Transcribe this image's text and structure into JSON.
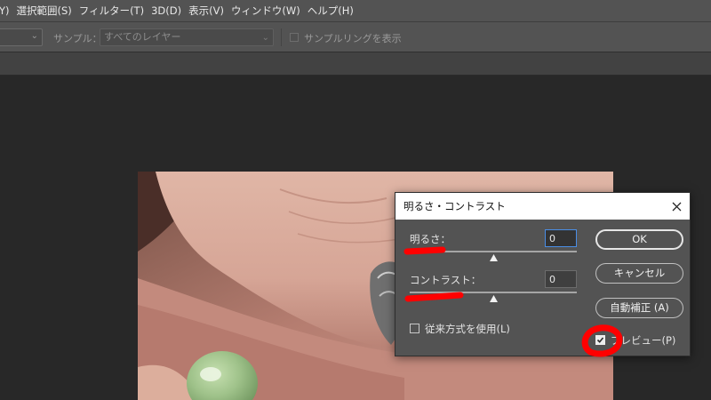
{
  "menu": [
    {
      "label": "Y)"
    },
    {
      "label": "選択範囲(S)"
    },
    {
      "label": "フィルター(T)"
    },
    {
      "label": "3D(D)"
    },
    {
      "label": "表示(V)"
    },
    {
      "label": "ウィンドウ(W)"
    },
    {
      "label": "ヘルプ(H)"
    }
  ],
  "options_bar": {
    "sample_label": "サンプル：",
    "sample_value": "すべてのレイヤー",
    "show_sampling_ring": "サンプルリングを表示",
    "show_sampling_ring_checked": false
  },
  "dialog": {
    "title": "明るさ・コントラスト",
    "brightness": {
      "label": "明るさ：",
      "value": "0",
      "slider_fraction": 0.5
    },
    "contrast": {
      "label": "コントラスト：",
      "value": "0",
      "slider_fraction": 0.5
    },
    "legacy": {
      "label": "従来方式を使用(L)",
      "checked": false
    },
    "preview": {
      "label": "プレビュー(P)",
      "checked": true
    },
    "buttons": {
      "ok": "OK",
      "cancel": "キャンセル",
      "auto": "自動補正 (A)"
    }
  },
  "colors": {
    "chrome": "#535353",
    "canvas": "#282828",
    "annotation": "#ff0000",
    "focus": "#4a8ee6"
  }
}
